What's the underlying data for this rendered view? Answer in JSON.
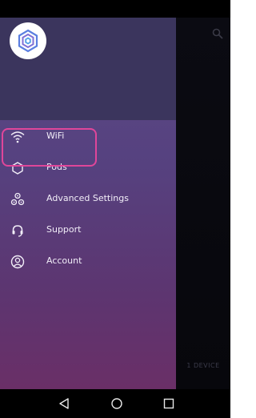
{
  "drawer": {
    "items": [
      {
        "label": "WiFi",
        "icon": "wifi-icon"
      },
      {
        "label": "Pods",
        "icon": "pod-hexagon-icon"
      },
      {
        "label": "Advanced Settings",
        "icon": "advanced-settings-icon"
      },
      {
        "label": "Support",
        "icon": "headset-icon"
      },
      {
        "label": "Account",
        "icon": "account-icon"
      }
    ]
  },
  "main": {
    "device_count": "1 DEVICE"
  },
  "navigation": [
    "back-icon",
    "home-icon",
    "recents-icon"
  ],
  "colors": {
    "drawer_header": "#3b355d",
    "drawer_top": "#5b4a86",
    "drawer_bottom": "#6a2f67",
    "highlight": "#e0469a"
  }
}
